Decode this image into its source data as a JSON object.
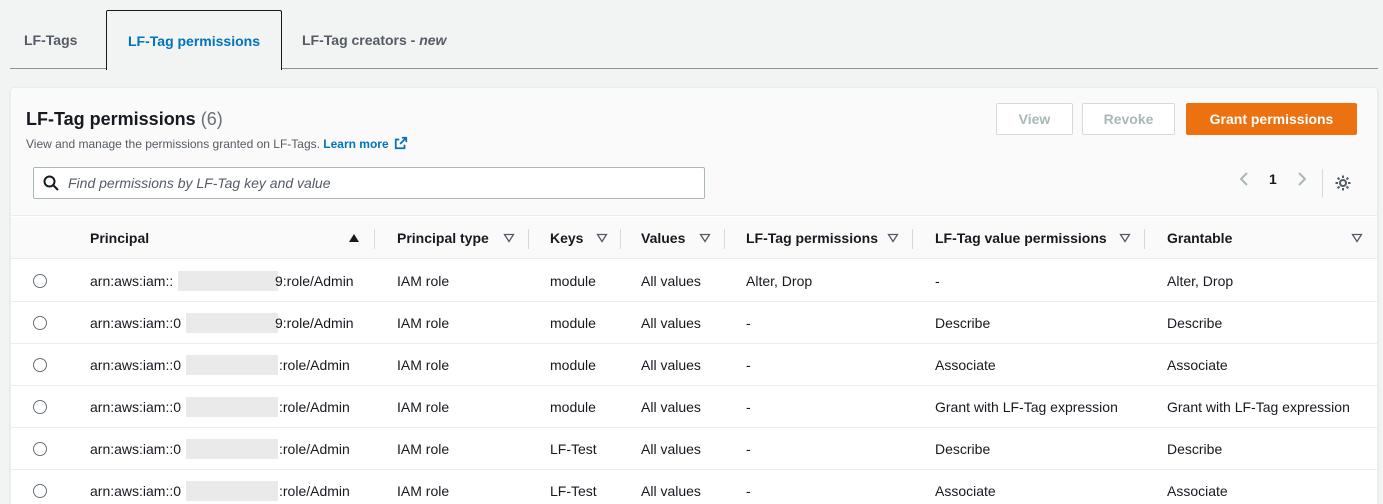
{
  "tabs": [
    {
      "label": "LF-Tags",
      "active": false
    },
    {
      "label": "LF-Tag permissions",
      "active": true
    },
    {
      "label": "LF-Tag creators - ",
      "label_emphasis": "new",
      "active": false
    }
  ],
  "header": {
    "title": "LF-Tag permissions",
    "count": "(6)",
    "description": "View and manage the permissions granted on LF-Tags.",
    "learn_more": "Learn more"
  },
  "buttons": {
    "view": "View",
    "revoke": "Revoke",
    "grant": "Grant permissions"
  },
  "search": {
    "placeholder": "Find permissions by LF-Tag key and value"
  },
  "pagination": {
    "current_page": "1"
  },
  "colors": {
    "accent": "#0073bb",
    "primary_button": "#ec7211"
  },
  "table": {
    "columns": [
      {
        "label": "Principal",
        "sort": "ascending"
      },
      {
        "label": "Principal type",
        "sort": "none"
      },
      {
        "label": "Keys",
        "sort": "none"
      },
      {
        "label": "Values",
        "sort": "none"
      },
      {
        "label": "LF-Tag permissions",
        "sort": "none"
      },
      {
        "label": "LF-Tag value permissions",
        "sort": "none"
      },
      {
        "label": "Grantable",
        "sort": "none"
      }
    ],
    "rows": [
      {
        "principal_prefix": "arn:aws:iam::",
        "principal_suffix": "9:role/Admin",
        "type": "IAM role",
        "keys": "module",
        "values": "All values",
        "tag_perms": "Alter, Drop",
        "value_perms": "-",
        "grantable": "Alter, Drop"
      },
      {
        "principal_prefix": "arn:aws:iam::0",
        "principal_suffix": "9:role/Admin",
        "type": "IAM role",
        "keys": "module",
        "values": "All values",
        "tag_perms": "-",
        "value_perms": "Describe",
        "grantable": "Describe"
      },
      {
        "principal_prefix": "arn:aws:iam::0",
        "principal_suffix": ":role/Admin",
        "type": "IAM role",
        "keys": "module",
        "values": "All values",
        "tag_perms": "-",
        "value_perms": "Associate",
        "grantable": "Associate"
      },
      {
        "principal_prefix": "arn:aws:iam::0",
        "principal_suffix": ":role/Admin",
        "type": "IAM role",
        "keys": "module",
        "values": "All values",
        "tag_perms": "-",
        "value_perms": "Grant with LF-Tag expression",
        "grantable": "Grant with LF-Tag expression"
      },
      {
        "principal_prefix": "arn:aws:iam::0",
        "principal_suffix": ":role/Admin",
        "type": "IAM role",
        "keys": "LF-Test",
        "values": "All values",
        "tag_perms": "-",
        "value_perms": "Describe",
        "grantable": "Describe"
      },
      {
        "principal_prefix": "arn:aws:iam::0",
        "principal_suffix": ":role/Admin",
        "type": "IAM role",
        "keys": "LF-Test",
        "values": "All values",
        "tag_perms": "-",
        "value_perms": "Associate",
        "grantable": "Associate"
      }
    ]
  }
}
